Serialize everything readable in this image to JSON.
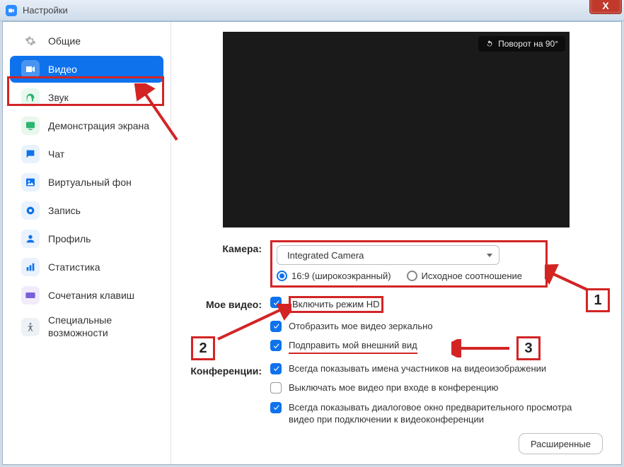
{
  "window": {
    "title": "Настройки"
  },
  "close": "X",
  "sidebar": {
    "items": [
      {
        "label": "Общие"
      },
      {
        "label": "Видео"
      },
      {
        "label": "Звук"
      },
      {
        "label": "Демонстрация экрана"
      },
      {
        "label": "Чат"
      },
      {
        "label": "Виртуальный фон"
      },
      {
        "label": "Запись"
      },
      {
        "label": "Профиль"
      },
      {
        "label": "Статистика"
      },
      {
        "label": "Сочетания клавиш"
      },
      {
        "label": "Специальные возможности"
      }
    ]
  },
  "rotate_label": "Поворот на 90°",
  "labels": {
    "camera": "Камера:",
    "myvideo": "Мое видео:",
    "meetings": "Конференции:"
  },
  "camera": {
    "selected": "Integrated Camera",
    "ratio_169": "16:9 (широкоэкранный)",
    "ratio_orig": "Исходное соотношение"
  },
  "myvideo": {
    "hd": "Включить режим HD",
    "mirror": "Отобразить мое видео зеркально",
    "touchup": "Подправить мой внешний вид"
  },
  "meetings": {
    "names": "Всегда показывать имена участников на видеоизображении",
    "video_off": "Выключать мое видео при входе в конференцию",
    "preview": "Всегда показывать диалоговое окно предварительного просмотра видео при подключении к видеоконференции"
  },
  "advanced": "Расширенные",
  "anno": {
    "n1": "1",
    "n2": "2",
    "n3": "3"
  }
}
